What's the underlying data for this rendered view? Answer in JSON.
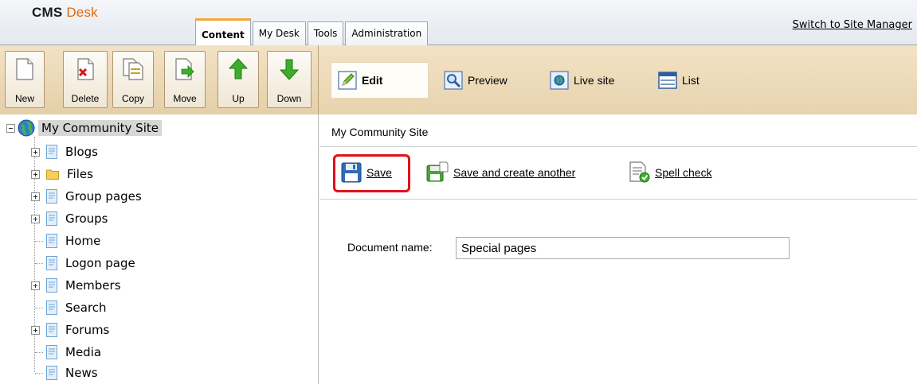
{
  "header": {
    "logo_cms": "CMS",
    "logo_desk": "Desk",
    "tabs": [
      {
        "label": "Content",
        "active": true
      },
      {
        "label": "My Desk",
        "active": false
      },
      {
        "label": "Tools",
        "active": false
      },
      {
        "label": "Administration",
        "active": false
      }
    ],
    "switch_link": "Switch to Site Manager"
  },
  "left_toolbar": {
    "buttons": [
      {
        "label": "New",
        "icon": "new-document-icon"
      },
      {
        "label": "Delete",
        "icon": "delete-document-icon"
      },
      {
        "label": "Copy",
        "icon": "copy-document-icon"
      },
      {
        "label": "Move",
        "icon": "move-document-icon"
      },
      {
        "label": "Up",
        "icon": "arrow-up-icon"
      },
      {
        "label": "Down",
        "icon": "arrow-down-icon"
      }
    ]
  },
  "view_toolbar": {
    "buttons": [
      {
        "label": "Edit",
        "icon": "edit-pencil-icon",
        "active": true
      },
      {
        "label": "Preview",
        "icon": "preview-magnifier-icon",
        "active": false
      },
      {
        "label": "Live site",
        "icon": "live-site-globe-icon",
        "active": false
      },
      {
        "label": "List",
        "icon": "list-icon",
        "active": false
      }
    ]
  },
  "tree": {
    "root": "My Community Site",
    "items": [
      {
        "label": "Blogs",
        "expandable": true,
        "icon": "page-icon"
      },
      {
        "label": "Files",
        "expandable": true,
        "icon": "folder-icon"
      },
      {
        "label": "Group pages",
        "expandable": true,
        "icon": "page-icon"
      },
      {
        "label": "Groups",
        "expandable": true,
        "icon": "page-icon"
      },
      {
        "label": "Home",
        "expandable": false,
        "icon": "page-icon"
      },
      {
        "label": "Logon page",
        "expandable": false,
        "icon": "page-icon"
      },
      {
        "label": "Members",
        "expandable": true,
        "icon": "page-icon"
      },
      {
        "label": "Search",
        "expandable": false,
        "icon": "page-icon"
      },
      {
        "label": "Forums",
        "expandable": true,
        "icon": "page-icon"
      },
      {
        "label": "Media",
        "expandable": false,
        "icon": "page-icon"
      },
      {
        "label": "News",
        "expandable": false,
        "icon": "page-icon"
      }
    ]
  },
  "content": {
    "breadcrumb": "My Community Site",
    "actions": {
      "save": "Save",
      "save_create": "Save and create another",
      "spell_check": "Spell check"
    },
    "form": {
      "doc_name_label": "Document name:",
      "doc_name_value": "Special pages"
    }
  },
  "colors": {
    "accent_orange": "#e06a0c",
    "toolbar_bg": "#f3e2c4",
    "highlight_red": "#e0121a"
  }
}
